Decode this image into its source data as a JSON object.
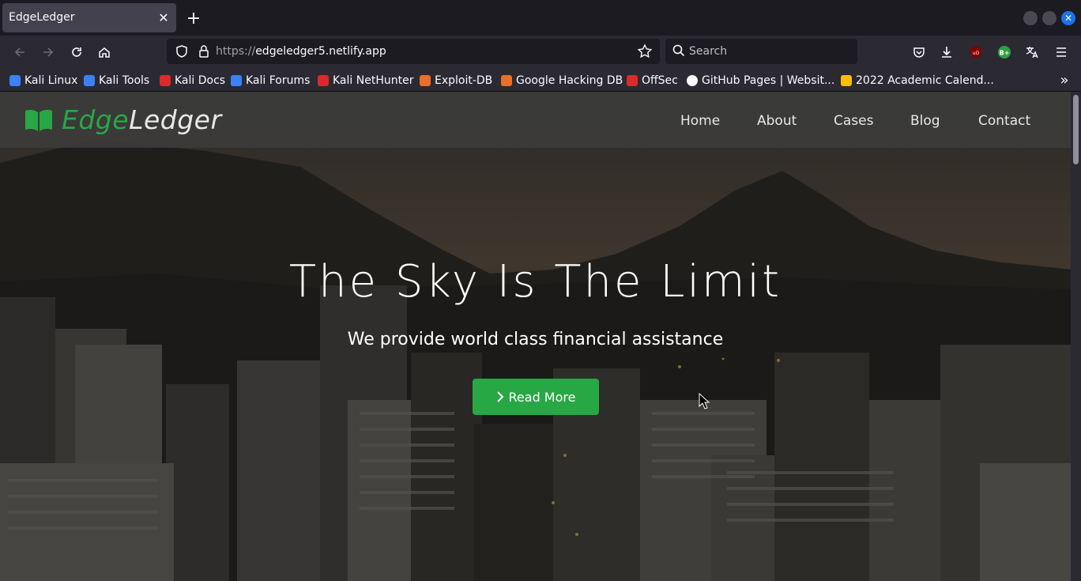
{
  "browser": {
    "tab": {
      "title": "EdgeLedger"
    },
    "url": {
      "scheme": "https://",
      "host": "edgeledger5.netlify.app"
    },
    "search": {
      "placeholder": "Search"
    },
    "accent": "#1a73e8",
    "toolbar_icons": [
      "back-icon",
      "forward-icon",
      "reload-icon",
      "home-icon",
      "shield-icon",
      "lock-icon",
      "star-icon",
      "pocket-icon",
      "download-icon",
      "ublock-icon",
      "bplus-icon",
      "translate-icon",
      "menu-icon"
    ],
    "ublock_label": "uO",
    "bplus_label": "B+",
    "bookmarks": [
      {
        "label": "Kali Linux",
        "color": "#3b82f6"
      },
      {
        "label": "Kali Tools",
        "color": "#3b82f6"
      },
      {
        "label": "Kali Docs",
        "color": "#d92b2b"
      },
      {
        "label": "Kali Forums",
        "color": "#3b82f6"
      },
      {
        "label": "Kali NetHunter",
        "color": "#d92b2b"
      },
      {
        "label": "Exploit-DB",
        "color": "#e8702a"
      },
      {
        "label": "Google Hacking DB",
        "color": "#e8702a"
      },
      {
        "label": "OffSec",
        "color": "#d92b2b"
      },
      {
        "label": "GitHub Pages | Websit...",
        "color": "#fbfbfe"
      },
      {
        "label": "2022 Academic Calend...",
        "color": "#fbbc04"
      }
    ]
  },
  "site": {
    "logo": {
      "part1": "Edge",
      "part2": "Ledger",
      "brand_color": "#28a745"
    },
    "nav": [
      "Home",
      "About",
      "Cases",
      "Blog",
      "Contact"
    ],
    "hero": {
      "title": "The Sky Is The Limit",
      "subtitle": "We provide world class financial assistance",
      "cta": "Read More"
    }
  }
}
